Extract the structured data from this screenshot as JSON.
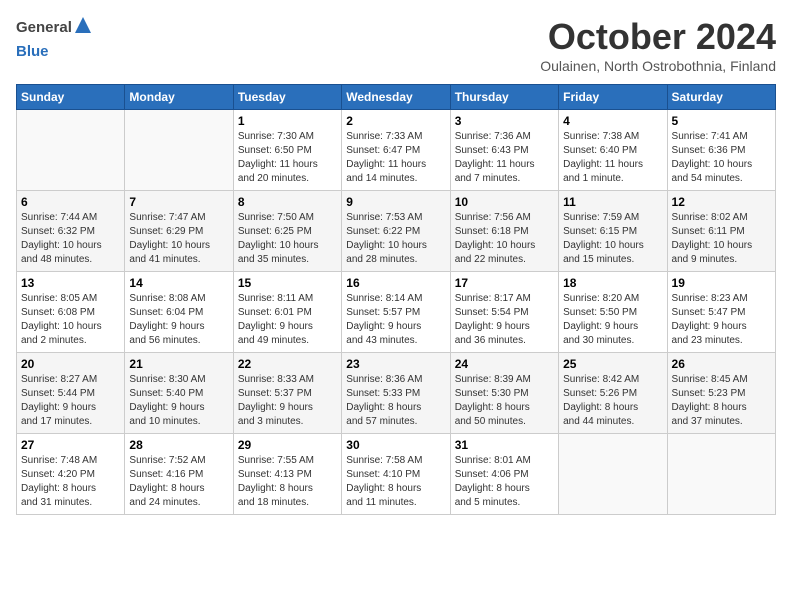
{
  "header": {
    "logo_general": "General",
    "logo_blue": "Blue",
    "title": "October 2024",
    "subtitle": "Oulainen, North Ostrobothnia, Finland"
  },
  "days_of_week": [
    "Sunday",
    "Monday",
    "Tuesday",
    "Wednesday",
    "Thursday",
    "Friday",
    "Saturday"
  ],
  "weeks": [
    [
      {
        "day": "",
        "info": ""
      },
      {
        "day": "",
        "info": ""
      },
      {
        "day": "1",
        "info": "Sunrise: 7:30 AM\nSunset: 6:50 PM\nDaylight: 11 hours\nand 20 minutes."
      },
      {
        "day": "2",
        "info": "Sunrise: 7:33 AM\nSunset: 6:47 PM\nDaylight: 11 hours\nand 14 minutes."
      },
      {
        "day": "3",
        "info": "Sunrise: 7:36 AM\nSunset: 6:43 PM\nDaylight: 11 hours\nand 7 minutes."
      },
      {
        "day": "4",
        "info": "Sunrise: 7:38 AM\nSunset: 6:40 PM\nDaylight: 11 hours\nand 1 minute."
      },
      {
        "day": "5",
        "info": "Sunrise: 7:41 AM\nSunset: 6:36 PM\nDaylight: 10 hours\nand 54 minutes."
      }
    ],
    [
      {
        "day": "6",
        "info": "Sunrise: 7:44 AM\nSunset: 6:32 PM\nDaylight: 10 hours\nand 48 minutes."
      },
      {
        "day": "7",
        "info": "Sunrise: 7:47 AM\nSunset: 6:29 PM\nDaylight: 10 hours\nand 41 minutes."
      },
      {
        "day": "8",
        "info": "Sunrise: 7:50 AM\nSunset: 6:25 PM\nDaylight: 10 hours\nand 35 minutes."
      },
      {
        "day": "9",
        "info": "Sunrise: 7:53 AM\nSunset: 6:22 PM\nDaylight: 10 hours\nand 28 minutes."
      },
      {
        "day": "10",
        "info": "Sunrise: 7:56 AM\nSunset: 6:18 PM\nDaylight: 10 hours\nand 22 minutes."
      },
      {
        "day": "11",
        "info": "Sunrise: 7:59 AM\nSunset: 6:15 PM\nDaylight: 10 hours\nand 15 minutes."
      },
      {
        "day": "12",
        "info": "Sunrise: 8:02 AM\nSunset: 6:11 PM\nDaylight: 10 hours\nand 9 minutes."
      }
    ],
    [
      {
        "day": "13",
        "info": "Sunrise: 8:05 AM\nSunset: 6:08 PM\nDaylight: 10 hours\nand 2 minutes."
      },
      {
        "day": "14",
        "info": "Sunrise: 8:08 AM\nSunset: 6:04 PM\nDaylight: 9 hours\nand 56 minutes."
      },
      {
        "day": "15",
        "info": "Sunrise: 8:11 AM\nSunset: 6:01 PM\nDaylight: 9 hours\nand 49 minutes."
      },
      {
        "day": "16",
        "info": "Sunrise: 8:14 AM\nSunset: 5:57 PM\nDaylight: 9 hours\nand 43 minutes."
      },
      {
        "day": "17",
        "info": "Sunrise: 8:17 AM\nSunset: 5:54 PM\nDaylight: 9 hours\nand 36 minutes."
      },
      {
        "day": "18",
        "info": "Sunrise: 8:20 AM\nSunset: 5:50 PM\nDaylight: 9 hours\nand 30 minutes."
      },
      {
        "day": "19",
        "info": "Sunrise: 8:23 AM\nSunset: 5:47 PM\nDaylight: 9 hours\nand 23 minutes."
      }
    ],
    [
      {
        "day": "20",
        "info": "Sunrise: 8:27 AM\nSunset: 5:44 PM\nDaylight: 9 hours\nand 17 minutes."
      },
      {
        "day": "21",
        "info": "Sunrise: 8:30 AM\nSunset: 5:40 PM\nDaylight: 9 hours\nand 10 minutes."
      },
      {
        "day": "22",
        "info": "Sunrise: 8:33 AM\nSunset: 5:37 PM\nDaylight: 9 hours\nand 3 minutes."
      },
      {
        "day": "23",
        "info": "Sunrise: 8:36 AM\nSunset: 5:33 PM\nDaylight: 8 hours\nand 57 minutes."
      },
      {
        "day": "24",
        "info": "Sunrise: 8:39 AM\nSunset: 5:30 PM\nDaylight: 8 hours\nand 50 minutes."
      },
      {
        "day": "25",
        "info": "Sunrise: 8:42 AM\nSunset: 5:26 PM\nDaylight: 8 hours\nand 44 minutes."
      },
      {
        "day": "26",
        "info": "Sunrise: 8:45 AM\nSunset: 5:23 PM\nDaylight: 8 hours\nand 37 minutes."
      }
    ],
    [
      {
        "day": "27",
        "info": "Sunrise: 7:48 AM\nSunset: 4:20 PM\nDaylight: 8 hours\nand 31 minutes."
      },
      {
        "day": "28",
        "info": "Sunrise: 7:52 AM\nSunset: 4:16 PM\nDaylight: 8 hours\nand 24 minutes."
      },
      {
        "day": "29",
        "info": "Sunrise: 7:55 AM\nSunset: 4:13 PM\nDaylight: 8 hours\nand 18 minutes."
      },
      {
        "day": "30",
        "info": "Sunrise: 7:58 AM\nSunset: 4:10 PM\nDaylight: 8 hours\nand 11 minutes."
      },
      {
        "day": "31",
        "info": "Sunrise: 8:01 AM\nSunset: 4:06 PM\nDaylight: 8 hours\nand 5 minutes."
      },
      {
        "day": "",
        "info": ""
      },
      {
        "day": "",
        "info": ""
      }
    ]
  ]
}
